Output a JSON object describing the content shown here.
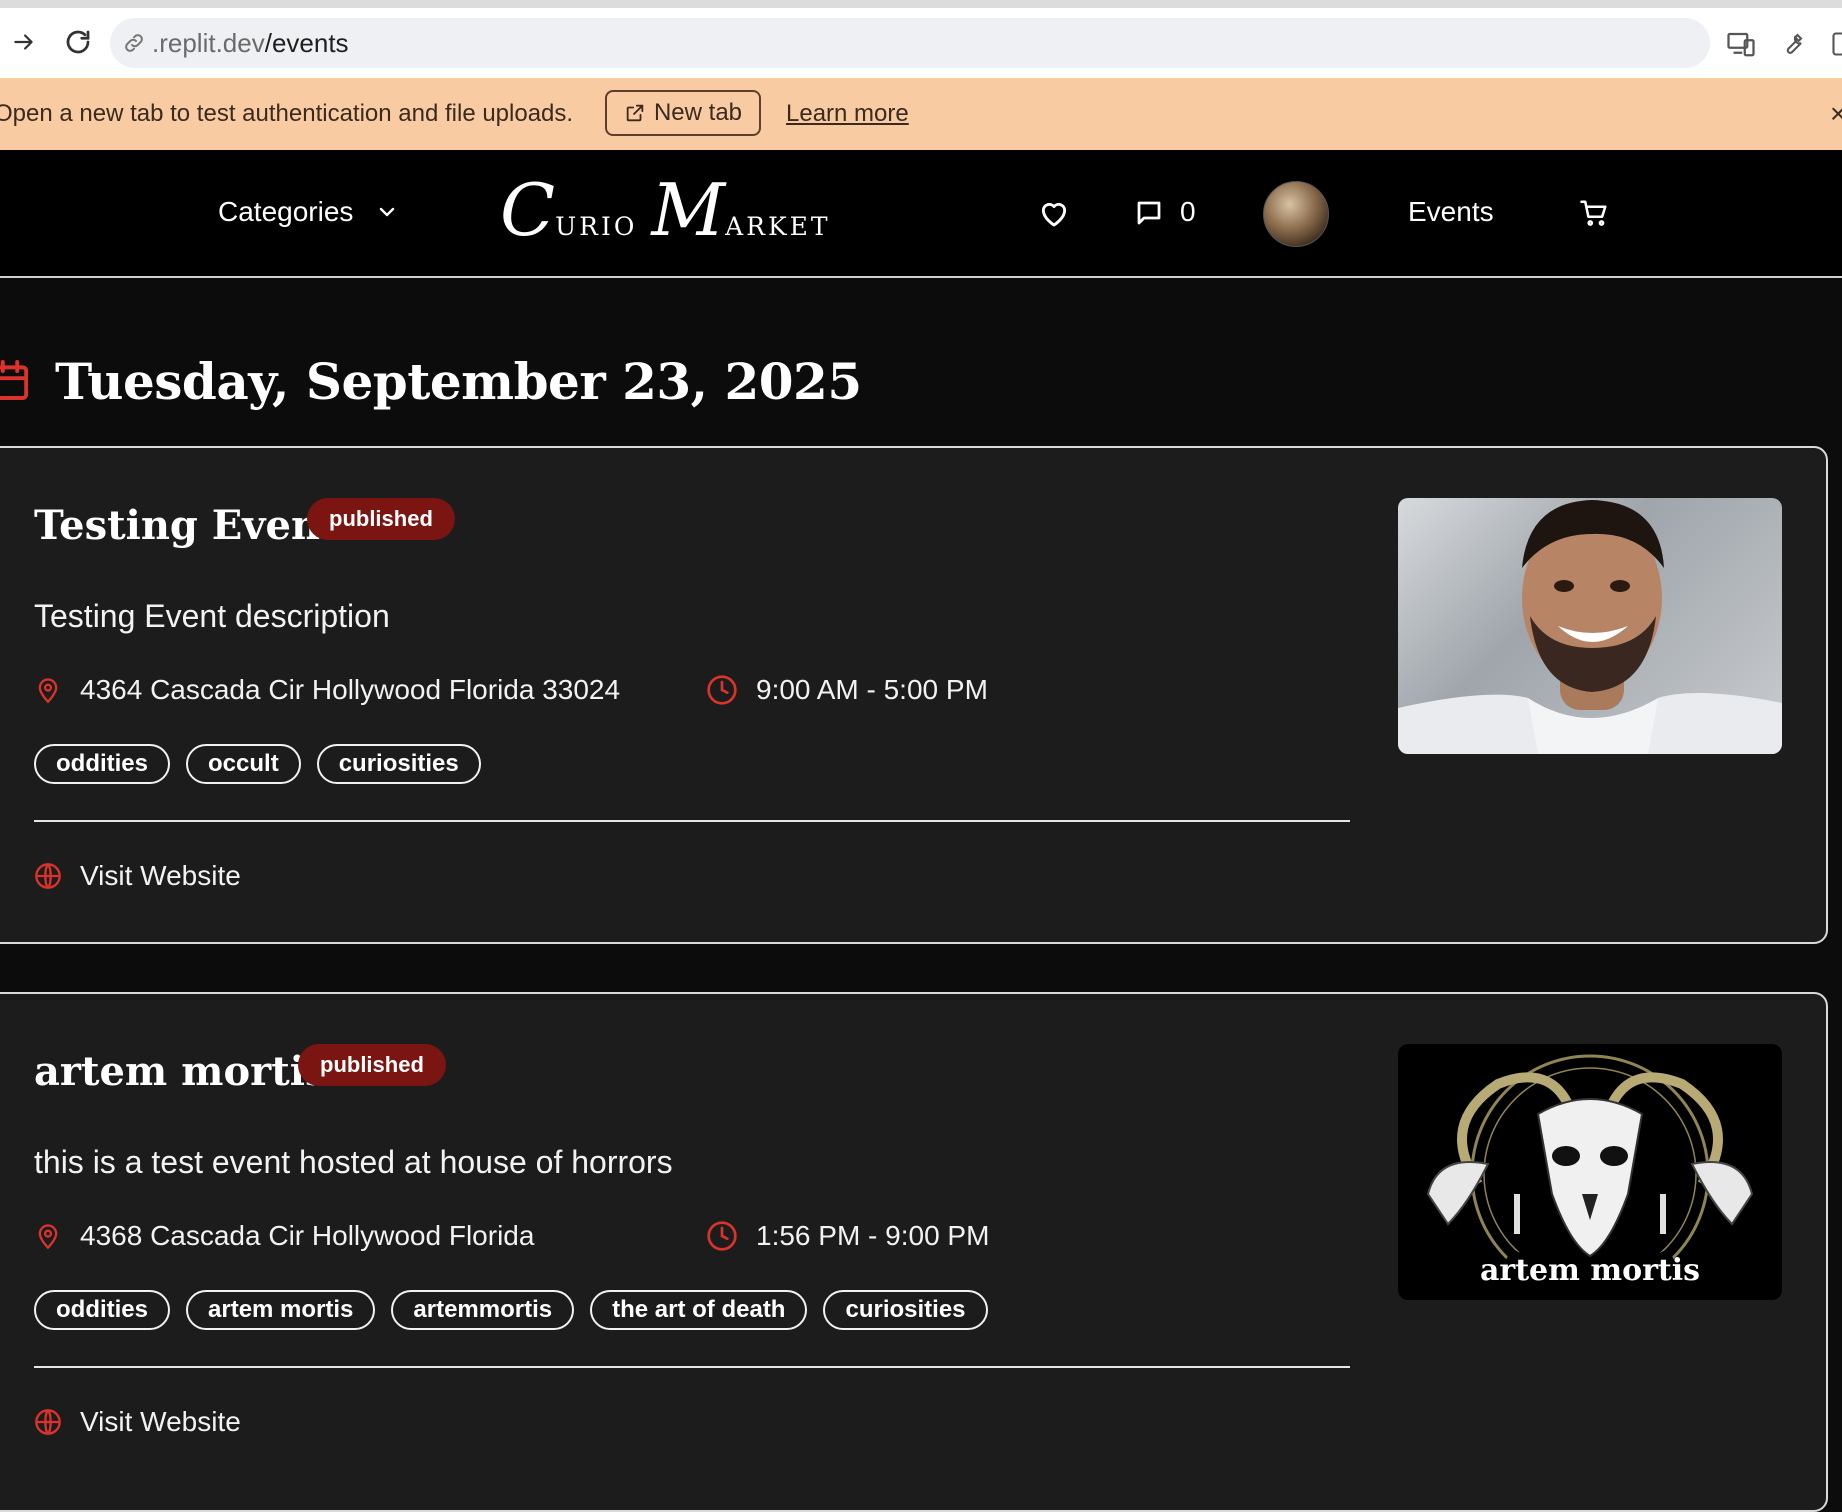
{
  "browser": {
    "url_prefix": ".replit.dev",
    "url_path": "/events"
  },
  "notice": {
    "message": "Open a new tab to test authentication and file uploads.",
    "new_tab_label": "New tab",
    "learn_more_label": "Learn more",
    "close_glyph": "×"
  },
  "header": {
    "categories_label": "Categories",
    "logo": {
      "c": "C",
      "urio": "urio",
      "m": "M",
      "arket": "arket"
    },
    "message_count": "0",
    "events_label": "Events"
  },
  "date_heading": "Tuesday, September 23, 2025",
  "events": [
    {
      "title": "Testing Event",
      "status": "published",
      "description": "Testing Event description",
      "address": "4364 Cascada Cir Hollywood Florida 33024",
      "time": "9:00 AM - 5:00 PM",
      "tags": [
        "oddities",
        "occult",
        "curiosities"
      ],
      "visit_label": "Visit Website"
    },
    {
      "title": "artem mortis",
      "status": "published",
      "description": "this is a test event hosted at house of horrors",
      "address": "4368 Cascada Cir Hollywood Florida",
      "time": "1:56 PM - 9:00 PM",
      "tags": [
        "oddities",
        "artem mortis",
        "artemmortis",
        "the art of death",
        "curiosities"
      ],
      "visit_label": "Visit Website",
      "image_text": "artem mortis"
    }
  ],
  "colors": {
    "accent_red": "#d9332b",
    "badge_bg": "#7a1512",
    "notice_bg": "#f9cba2",
    "card_bg": "#1c1c1c"
  },
  "icons": {
    "back": "arrow-right-icon",
    "reload": "reload-icon",
    "favorite": "heart-icon",
    "messages": "chat-bubble-icon",
    "cart": "cart-icon",
    "calendar": "calendar-icon",
    "location": "map-pin-icon",
    "time": "clock-icon",
    "website": "globe-icon"
  }
}
